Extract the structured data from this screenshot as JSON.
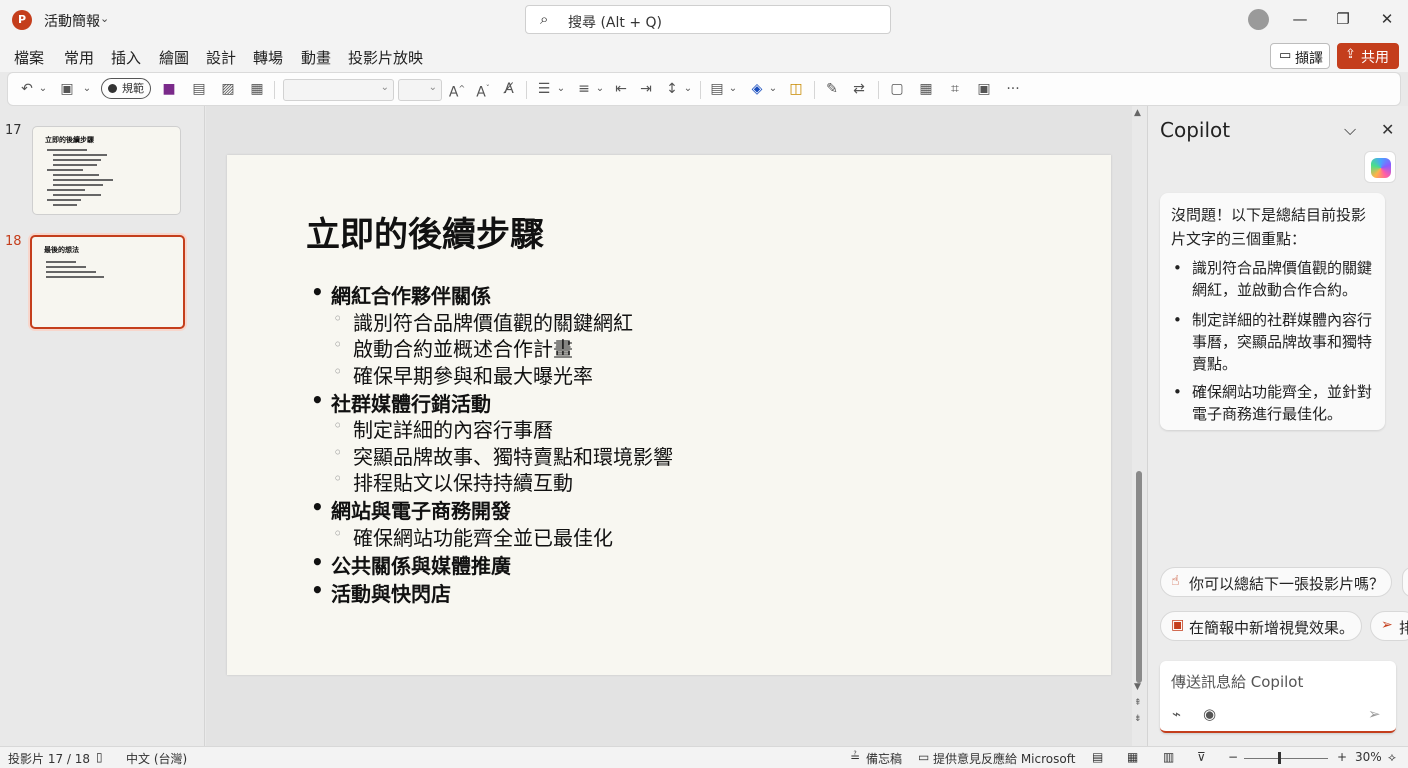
{
  "titlebar": {
    "app_icon_glyph": "P",
    "doc_title": "活動簡報",
    "search_placeholder": "搜尋 (Alt + Q)",
    "search_icon": "search-icon",
    "minimize": "—",
    "restore": "❐",
    "close": "✕"
  },
  "menu": {
    "items": [
      "檔案",
      "常用",
      "插入",
      "繪圖",
      "設計",
      "轉場",
      "動畫",
      "投影片放映"
    ],
    "comment_label": "擷譯",
    "share_label": "共用"
  },
  "ribbon": {
    "sensitivity_label": "規範",
    "undo_icon": "undo-icon",
    "paste_icon": "clipboard-icon",
    "more_label": "···"
  },
  "thumbnails": [
    {
      "number": "17",
      "title": "立即的後續步驟"
    },
    {
      "number": "18",
      "title": "最後的想法"
    }
  ],
  "slide": {
    "title": "立即的後續步驟",
    "bullets": [
      {
        "level": 1,
        "text": "網紅合作夥伴關係"
      },
      {
        "level": 2,
        "text": "識別符合品牌價值觀的關鍵網紅"
      },
      {
        "level": 2,
        "text": "啟動合約並概述合作計畫"
      },
      {
        "level": 2,
        "text": "確保早期參與和最大曝光率"
      },
      {
        "level": 1,
        "text": "社群媒體行銷活動"
      },
      {
        "level": 2,
        "text": "制定詳細的內容行事曆"
      },
      {
        "level": 2,
        "text": "突顯品牌故事、獨特賣點和環境影響"
      },
      {
        "level": 2,
        "text": "排程貼文以保持持續互動"
      },
      {
        "level": 1,
        "text": "網站與電子商務開發"
      },
      {
        "level": 2,
        "text": "確保網站功能齊全並已最佳化"
      },
      {
        "level": 1,
        "text": "公共關係與媒體推廣"
      },
      {
        "level": 1,
        "text": "活動與快閃店"
      }
    ]
  },
  "copilot": {
    "title": "Copilot",
    "collapse_icon": "⌵",
    "close_icon": "✕",
    "message_intro": "沒問題！以下是總結目前投影片文字的三個重點：",
    "message_points": [
      "識別符合品牌價值觀的關鍵網紅，並啟動合作合約。",
      "制定詳細的社群媒體內容行事曆，突顯品牌故事和獨特賣點。",
      "確保網站功能齊全，並針對電子商務進行最佳化。"
    ],
    "suggestions": [
      "你可以總結下一張投影片嗎？",
      "在簡報中新增視覺效果。",
      "排"
    ],
    "composer_placeholder": "傳送訊息給 Copilot"
  },
  "statusbar": {
    "slide_counter": "投影片 17 / 18",
    "language": "中文 (台灣)",
    "notes": "備忘稿",
    "feedback": "提供意見反應給 Microsoft",
    "zoom_minus": "−",
    "zoom_plus": "+",
    "zoom_level": "30%"
  },
  "colors": {
    "accent": "#c43e1c",
    "slide_bg": "#f8f7f1"
  }
}
